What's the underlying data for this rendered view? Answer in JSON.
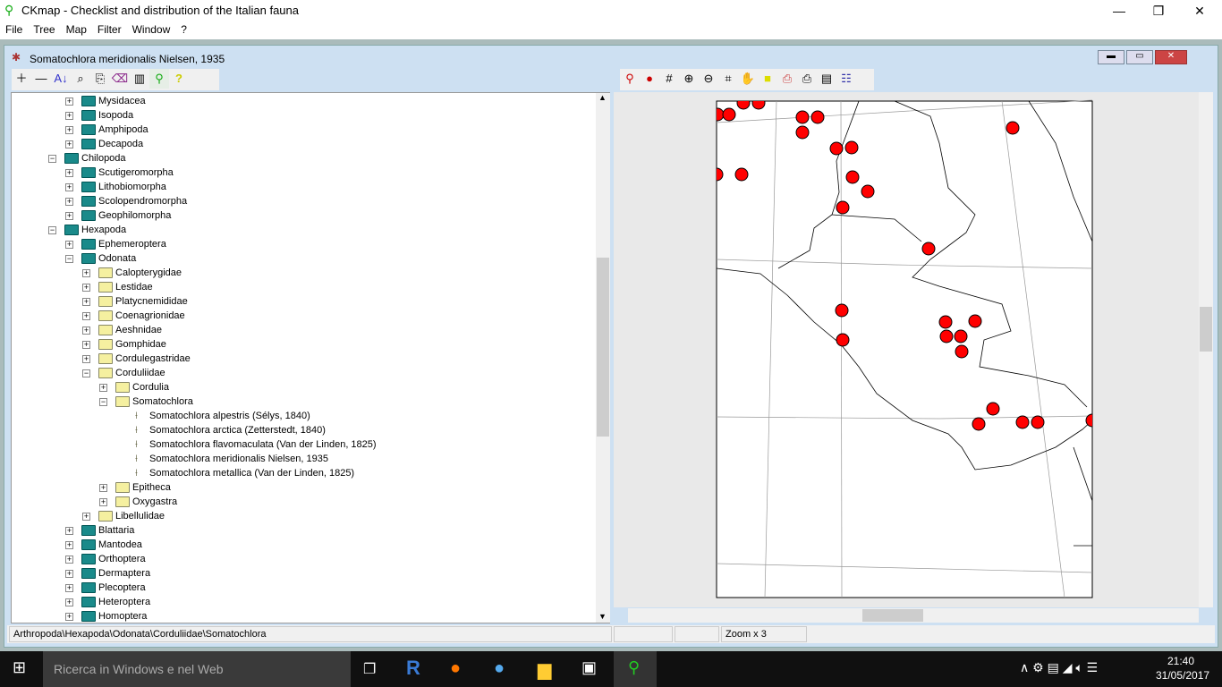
{
  "app": {
    "title": "CKmap - Checklist and distribution of the Italian fauna",
    "icon": "italy-map-icon"
  },
  "menu": [
    "File",
    "Tree",
    "Map",
    "Filter",
    "Window",
    "?"
  ],
  "child": {
    "title": "Somatochlora meridionalis Nielsen, 1935"
  },
  "toolbar_left": [
    "plus-icon",
    "minus-icon",
    "sort-az-icon",
    "binoculars-icon",
    "notes-icon",
    "eraser-icon",
    "book-icon",
    "italy-map-icon",
    "help-icon"
  ],
  "toolbar_right": [
    "italy-pin-icon",
    "pin-icon",
    "grid-icon",
    "zoom-in-icon",
    "zoom-out-icon",
    "crop-icon",
    "hand-icon",
    "yellow-note-icon",
    "print-color-icon",
    "print-icon",
    "properties-icon",
    "legend-icon"
  ],
  "tree": [
    {
      "label": "Mysidacea",
      "level": 2,
      "type": "teal",
      "expanded": false
    },
    {
      "label": "Isopoda",
      "level": 2,
      "type": "teal",
      "expanded": false
    },
    {
      "label": "Amphipoda",
      "level": 2,
      "type": "teal",
      "expanded": false
    },
    {
      "label": "Decapoda",
      "level": 2,
      "type": "teal",
      "expanded": false
    },
    {
      "label": "Chilopoda",
      "level": 1,
      "type": "teal",
      "expanded": true
    },
    {
      "label": "Scutigeromorpha",
      "level": 2,
      "type": "teal",
      "expanded": false
    },
    {
      "label": "Lithobiomorpha",
      "level": 2,
      "type": "teal",
      "expanded": false
    },
    {
      "label": "Scolopendromorpha",
      "level": 2,
      "type": "teal",
      "expanded": false
    },
    {
      "label": "Geophilomorpha",
      "level": 2,
      "type": "teal",
      "expanded": false
    },
    {
      "label": "Hexapoda",
      "level": 1,
      "type": "teal",
      "expanded": true
    },
    {
      "label": "Ephemeroptera",
      "level": 2,
      "type": "teal",
      "expanded": false
    },
    {
      "label": "Odonata",
      "level": 2,
      "type": "teal",
      "expanded": true
    },
    {
      "label": "Calopterygidae",
      "level": 3,
      "type": "yellow",
      "expanded": false
    },
    {
      "label": "Lestidae",
      "level": 3,
      "type": "yellow",
      "expanded": false
    },
    {
      "label": "Platycnemididae",
      "level": 3,
      "type": "yellow",
      "expanded": false
    },
    {
      "label": "Coenagrionidae",
      "level": 3,
      "type": "yellow",
      "expanded": false
    },
    {
      "label": "Aeshnidae",
      "level": 3,
      "type": "yellow",
      "expanded": false
    },
    {
      "label": "Gomphidae",
      "level": 3,
      "type": "yellow",
      "expanded": false
    },
    {
      "label": "Cordulegastridae",
      "level": 3,
      "type": "yellow",
      "expanded": false
    },
    {
      "label": "Corduliidae",
      "level": 3,
      "type": "yellow",
      "expanded": true
    },
    {
      "label": "Cordulia",
      "level": 4,
      "type": "yellow",
      "expanded": false
    },
    {
      "label": "Somatochlora",
      "level": 4,
      "type": "yellow",
      "expanded": true
    },
    {
      "label": "Somatochlora alpestris (Sélys, 1840)",
      "level": 5,
      "type": "species"
    },
    {
      "label": "Somatochlora arctica (Zetterstedt, 1840)",
      "level": 5,
      "type": "species"
    },
    {
      "label": "Somatochlora flavomaculata (Van der Linden, 1825)",
      "level": 5,
      "type": "species"
    },
    {
      "label": "Somatochlora meridionalis Nielsen, 1935",
      "level": 5,
      "type": "species"
    },
    {
      "label": "Somatochlora metallica (Van der Linden, 1825)",
      "level": 5,
      "type": "species"
    },
    {
      "label": "Epitheca",
      "level": 4,
      "type": "yellow",
      "expanded": false
    },
    {
      "label": "Oxygastra",
      "level": 4,
      "type": "yellow",
      "expanded": false
    },
    {
      "label": "Libellulidae",
      "level": 3,
      "type": "yellow",
      "expanded": false
    },
    {
      "label": "Blattaria",
      "level": 2,
      "type": "teal",
      "expanded": false
    },
    {
      "label": "Mantodea",
      "level": 2,
      "type": "teal",
      "expanded": false
    },
    {
      "label": "Orthoptera",
      "level": 2,
      "type": "teal",
      "expanded": false
    },
    {
      "label": "Dermaptera",
      "level": 2,
      "type": "teal",
      "expanded": false
    },
    {
      "label": "Plecoptera",
      "level": 2,
      "type": "teal",
      "expanded": false
    },
    {
      "label": "Heteroptera",
      "level": 2,
      "type": "teal",
      "expanded": false
    },
    {
      "label": "Homoptera",
      "level": 2,
      "type": "teal",
      "expanded": false
    }
  ],
  "status": {
    "path": "Arthropoda\\Hexapoda\\Odonata\\Corduliidae\\Somatochlora",
    "field2": "",
    "field3": "",
    "zoom": "Zoom  x 3"
  },
  "colors": {
    "record_dot": "#ff0000",
    "teal_folder": "#1a8a8a",
    "yellow_folder": "#f5f0a0"
  },
  "taskbar": {
    "search_placeholder": "Ricerca in Windows e nel Web",
    "time": "21:40",
    "date": "31/05/2017",
    "apps": [
      "task-view-icon",
      "r-icon",
      "firefox-icon",
      "thunderbird-icon",
      "file-explorer-icon",
      "cmd-icon",
      "ckmap-icon"
    ]
  }
}
